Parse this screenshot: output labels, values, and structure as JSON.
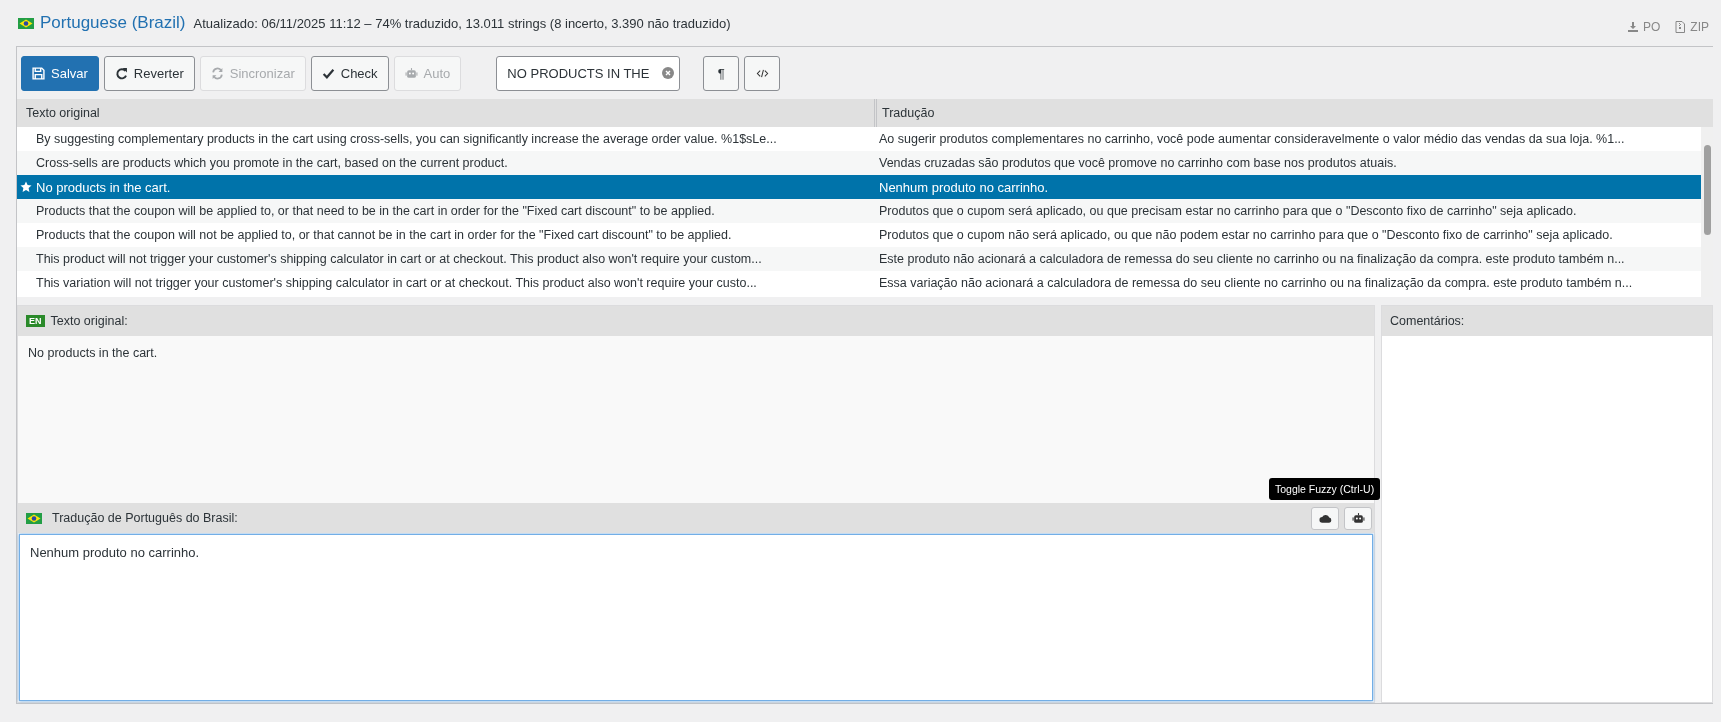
{
  "header": {
    "language": "Portuguese (Brazil)",
    "status": "Atualizado: 06/11/2025 11:12 – 74% traduzido, 13.011 strings (8 incerto, 3.390 não traduzido)",
    "downloads": [
      "PO",
      "ZIP"
    ]
  },
  "toolbar": {
    "buttons": [
      {
        "label": "Salvar",
        "kind": "primary",
        "disabled": false
      },
      {
        "label": "Reverter",
        "kind": "default",
        "disabled": false
      },
      {
        "label": "Sincronizar",
        "kind": "default",
        "disabled": true
      },
      {
        "label": "Check",
        "kind": "default",
        "disabled": false
      },
      {
        "label": "Auto",
        "kind": "default",
        "disabled": true
      }
    ],
    "search": {
      "value": "NO PRODUCTS IN THE"
    },
    "invisibles_button": {
      "label": "¶"
    }
  },
  "table": {
    "columns": [
      "Texto original",
      "Tradução"
    ],
    "rows": [
      {
        "source": "By suggesting complementary products in the cart using cross-sells, you can significantly increase the average order value. %1$sLe...",
        "translation": "Ao sugerir produtos complementares no carrinho, você pode aumentar consideravelmente o valor médio das vendas da sua loja. %1...",
        "selected": false,
        "starred": false
      },
      {
        "source": "Cross-sells are products which you promote in the cart, based on the current product.",
        "translation": "Vendas cruzadas são produtos que você promove no carrinho com base nos produtos atuais.",
        "selected": false,
        "starred": false
      },
      {
        "source": "No products in the cart.",
        "translation": "Nenhum produto no carrinho.",
        "selected": true,
        "starred": true
      },
      {
        "source": "Products that the coupon will be applied to, or that need to be in the cart in order for the \"Fixed cart discount\" to be applied.",
        "translation": "Produtos que o cupom será aplicado, ou que precisam estar no carrinho para que o \"Desconto fixo de carrinho\" seja aplicado.",
        "selected": false,
        "starred": false
      },
      {
        "source": "Products that the coupon will not be applied to, or that cannot be in the cart in order for the \"Fixed cart discount\" to be applied.",
        "translation": "Produtos que o cupom não será aplicado, ou que não podem estar no carrinho para que o \"Desconto fixo de carrinho\" seja aplicado.",
        "selected": false,
        "starred": false
      },
      {
        "source": "This product will not trigger your customer's shipping calculator in cart or at checkout. This product also won't require your custom...",
        "translation": "Este produto não acionará a calculadora de remessa do seu cliente no carrinho ou na finalização da compra. este produto também n...",
        "selected": false,
        "starred": false
      },
      {
        "source": "This variation will not trigger your customer's shipping calculator in cart or at checkout. This product also won't require your custo...",
        "translation": "Essa variação não acionará a calculadora de remessa do seu cliente no carrinho ou na finalização da compra. este produto também n...",
        "selected": false,
        "starred": false
      }
    ]
  },
  "editor": {
    "source": {
      "badge": "EN",
      "label": "Texto original:",
      "text": "No products in the cart."
    },
    "translation": {
      "label": "Tradução de Português do Brasil:",
      "value": "Nenhum produto no carrinho.",
      "tooltip": "Toggle Fuzzy (Ctrl-U)"
    },
    "comments": {
      "label": "Comentários:"
    }
  }
}
